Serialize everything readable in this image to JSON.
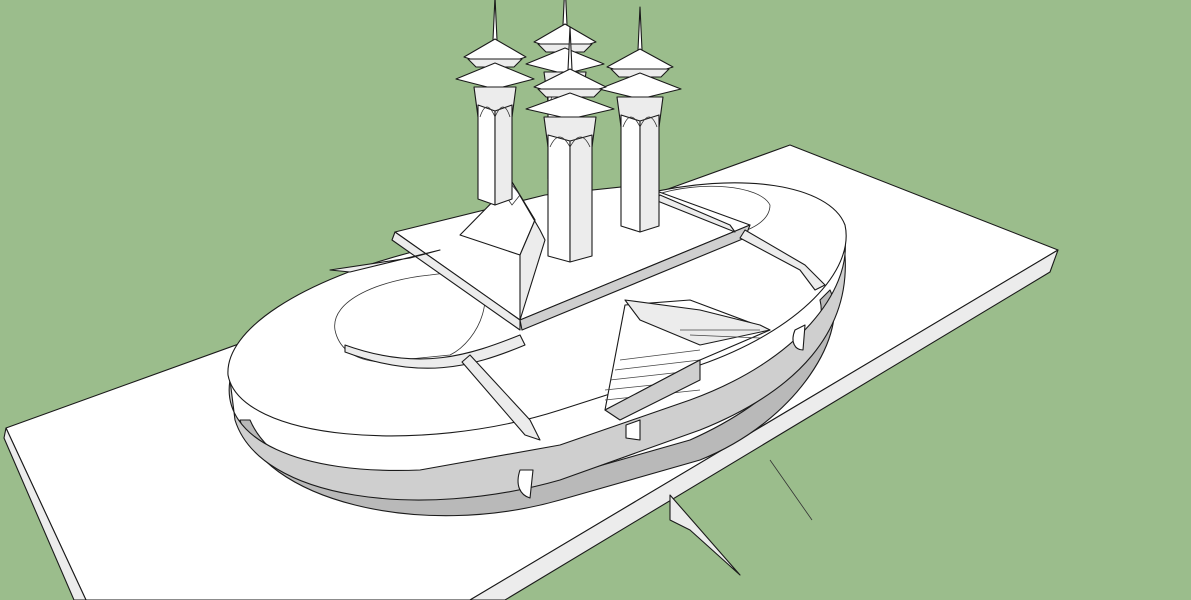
{
  "viewport": {
    "background_color": "#9bbd8c",
    "ground_color": "#ffffff",
    "shadow_color": "#c4c4c4",
    "edge_color": "#1a1a1a"
  },
  "model": {
    "tower_count": 4
  }
}
